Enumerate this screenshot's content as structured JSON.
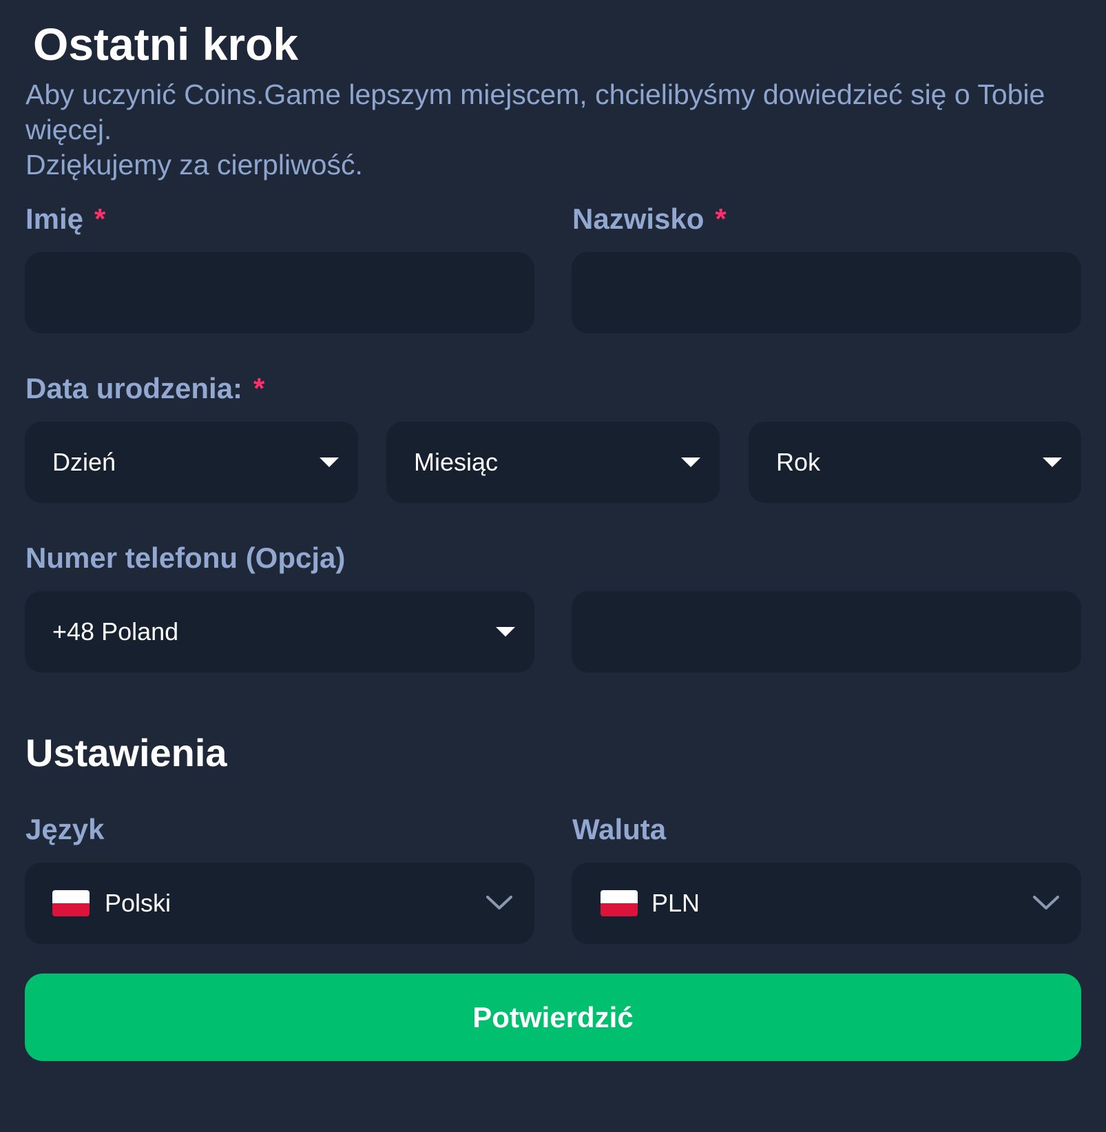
{
  "header": {
    "title": "Ostatni krok",
    "subtitle_line1": "Aby uczynić Coins.Game lepszym miejscem, chcielibyśmy dowiedzieć się o Tobie więcej.",
    "subtitle_line2": "Dziękujemy za cierpliwość."
  },
  "form": {
    "first_name": {
      "label": "Imię",
      "required_mark": "*",
      "value": ""
    },
    "last_name": {
      "label": "Nazwisko",
      "required_mark": "*",
      "value": ""
    },
    "birth_date": {
      "label": "Data urodzenia:",
      "required_mark": "*",
      "day": "Dzień",
      "month": "Miesiąc",
      "year": "Rok"
    },
    "phone": {
      "label": "Numer telefonu (Opcja)",
      "country_code": "+48 Poland",
      "number_value": ""
    }
  },
  "settings": {
    "title": "Ustawienia",
    "language": {
      "label": "Język",
      "value": "Polski"
    },
    "currency": {
      "label": "Waluta",
      "value": "PLN"
    }
  },
  "actions": {
    "confirm_label": "Potwierdzić"
  },
  "colors": {
    "background": "#1f2839",
    "field": "#17202e",
    "label": "#92a8d1",
    "required": "#ff2f6a",
    "accent": "#00bf6f"
  },
  "icons": {
    "dropdown": "caret-down-icon",
    "chevron": "chevron-down-icon",
    "flag": "poland-flag-icon"
  }
}
